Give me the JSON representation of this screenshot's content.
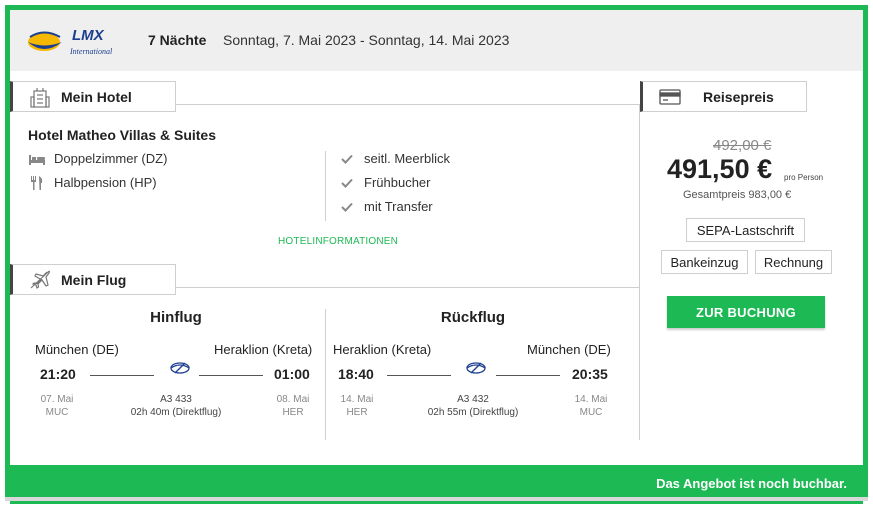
{
  "header": {
    "logo_text": "LMX",
    "logo_subtext": "International",
    "nights": "7 Nächte",
    "dates": "Sonntag, 7. Mai 2023 - Sonntag, 14. Mai 2023"
  },
  "hotel": {
    "section_label": "Mein Hotel",
    "name": "Hotel Matheo Villas & Suites",
    "room": "Doppelzimmer (DZ)",
    "board": "Halbpension (HP)",
    "features": [
      "seitl. Meerblick",
      "Frühbucher",
      "mit Transfer"
    ],
    "info_link": "HOTELINFORMATIONEN"
  },
  "flight": {
    "section_label": "Mein Flug",
    "outbound": {
      "title": "Hinflug",
      "from_city": "München (DE)",
      "to_city": "Heraklion (Kreta)",
      "dep_time": "21:20",
      "arr_time": "01:00",
      "dep_date": "07. Mai",
      "dep_code": "MUC",
      "arr_date": "08. Mai",
      "arr_code": "HER",
      "flight_no": "A3 433",
      "duration": "02h 40m (Direktflug)"
    },
    "return": {
      "title": "Rückflug",
      "from_city": "Heraklion (Kreta)",
      "to_city": "München (DE)",
      "dep_time": "18:40",
      "arr_time": "20:35",
      "dep_date": "14. Mai",
      "dep_code": "HER",
      "arr_date": "14. Mai",
      "arr_code": "MUC",
      "flight_no": "A3 432",
      "duration": "02h 55m (Direktflug)"
    }
  },
  "price": {
    "section_label": "Reisepreis",
    "old_price": "492,00 €",
    "price": "491,50 €",
    "per_person": "pro Person",
    "total": "Gesamtpreis 983,00 €",
    "payment_options": [
      "SEPA-Lastschrift",
      "Bankeinzug",
      "Rechnung"
    ],
    "book_label": "ZUR BUCHUNG"
  },
  "footer": {
    "status": "Das Angebot ist noch buchbar."
  },
  "colors": {
    "accent": "#1db954",
    "header_bg": "#efefef"
  }
}
